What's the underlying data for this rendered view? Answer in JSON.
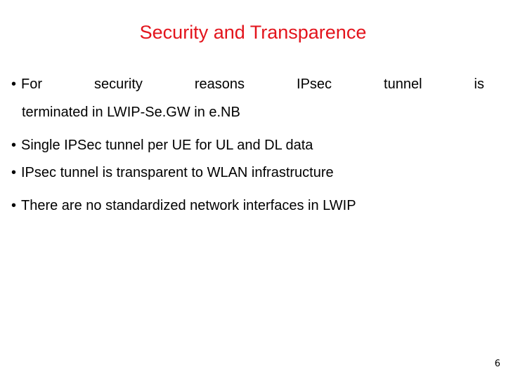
{
  "slide": {
    "title": "Security and Transparence",
    "title_color": "#e3141c",
    "bullet_glyph": "•",
    "bullets": [
      {
        "first_line_words": [
          "For",
          "security",
          "reasons",
          "IPsec",
          "tunnel",
          "is"
        ],
        "continuation": "terminated in LWIP-Se.GW in e.NB"
      },
      {
        "text": "Single IPSec tunnel per UE for UL and DL data"
      },
      {
        "text": "IPsec tunnel is transparent to WLAN infrastructure"
      },
      {
        "text": "There are no standardized network interfaces in LWIP"
      }
    ],
    "page_number": "6"
  }
}
